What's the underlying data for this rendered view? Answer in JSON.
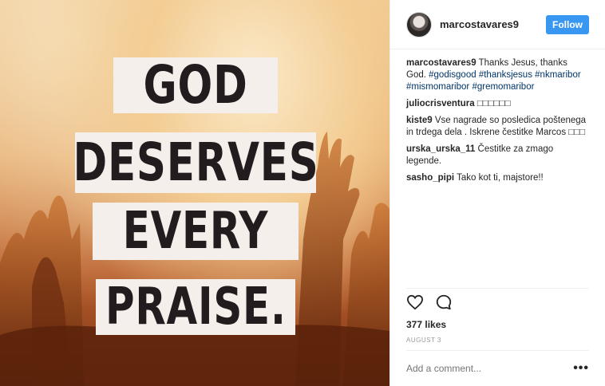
{
  "image": {
    "words": [
      "GOD",
      "DESERVES",
      "EVERY",
      "PRAISE."
    ]
  },
  "header": {
    "username": "marcostavares9",
    "follow_label": "Follow"
  },
  "caption": {
    "username": "marcostavares9",
    "text": "Thanks Jesus, thanks God.",
    "hashtags": [
      "#godisgood",
      "#thanksjesus",
      "#nkmaribor",
      "#mismomaribor",
      "#gremomaribor"
    ]
  },
  "comments": [
    {
      "username": "juliocrisventura",
      "text": "□□□□□□"
    },
    {
      "username": "kiste9",
      "text": "Vse nagrade so posledica poštenega in trdega dela . Iskrene čestitke Marcos □□□"
    },
    {
      "username": "urska_urska_11",
      "text": "Čestitke za zmago legende."
    },
    {
      "username": "sasho_pipi",
      "text": "Tako kot ti, majstore!!"
    }
  ],
  "actions": {
    "like_icon": "heart-icon",
    "comment_icon": "speech-bubble-icon",
    "likes_text": "377 likes",
    "date": "AUGUST 3"
  },
  "add_comment": {
    "placeholder": "Add a comment...",
    "more_label": "•••"
  }
}
